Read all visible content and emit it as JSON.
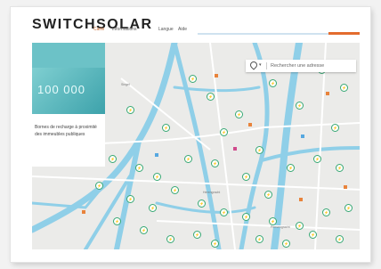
{
  "header": {
    "logo": "SWITCHSOLAR",
    "nav": [
      {
        "label": "Carte",
        "active": true
      },
      {
        "label": "Informations",
        "active": false
      },
      {
        "label": "Langue",
        "active": false
      },
      {
        "label": "Aide",
        "active": false
      }
    ]
  },
  "panel": {
    "stat": "100 000",
    "caption": "Bornes de recharge à proximité des immeubles publiques"
  },
  "search": {
    "placeholder": "Rechercher une adresse"
  },
  "map": {
    "marker_glyph": "⚡",
    "street_labels": [
      "Singel",
      "Herengracht",
      "Prinsengracht"
    ]
  },
  "colors": {
    "accent": "#e36b2e",
    "panel": "#6cc2c7",
    "water": "#8fcfe8",
    "marker": "#37a874"
  }
}
